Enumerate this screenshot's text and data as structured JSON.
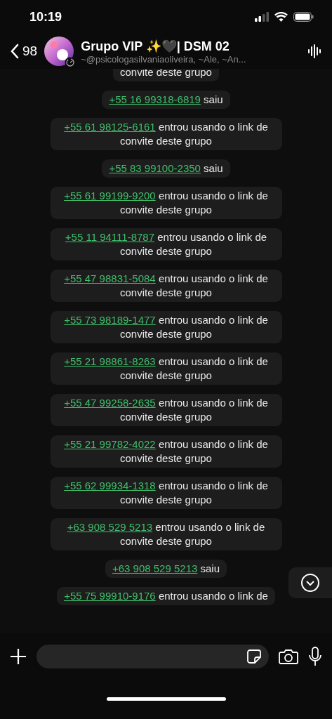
{
  "status_bar": {
    "time": "10:19"
  },
  "header": {
    "back_count": "98",
    "title": "Grupo VIP ✨🖤| DSM 02",
    "subtitle": "~@psicologasilvaniaoliveira, ~Ale, ~An..."
  },
  "messages": [
    {
      "kind": "fragment",
      "text": "convite deste grupo"
    },
    {
      "kind": "left",
      "phone": "+55 16 99318-6819",
      "text": "saiu"
    },
    {
      "kind": "join",
      "phone": "+55 61 98125-6161",
      "text": "entrou usando o link de convite deste grupo"
    },
    {
      "kind": "left",
      "phone": "+55 83 99100-2350",
      "text": "saiu"
    },
    {
      "kind": "join",
      "phone": "+55 61 99199-9200",
      "text": "entrou usando o link de convite deste grupo"
    },
    {
      "kind": "join",
      "phone": "+55 11 94111-8787",
      "text": "entrou usando o link de convite deste grupo"
    },
    {
      "kind": "join",
      "phone": "+55 47 98831-5084",
      "text": "entrou usando o link de convite deste grupo"
    },
    {
      "kind": "join",
      "phone": "+55 73 98189-1477",
      "text": "entrou usando o link de convite deste grupo"
    },
    {
      "kind": "join",
      "phone": "+55 21 98861-8263",
      "text": "entrou usando o link de convite deste grupo"
    },
    {
      "kind": "join",
      "phone": "+55 47 99258-2635",
      "text": "entrou usando o link de convite deste grupo"
    },
    {
      "kind": "join",
      "phone": "+55 21 99782-4022",
      "text": "entrou usando o link de convite deste grupo"
    },
    {
      "kind": "join",
      "phone": "+55 62 99934-1318",
      "text": "entrou usando o link de convite deste grupo"
    },
    {
      "kind": "join",
      "phone": "+63 908 529 5213",
      "text": "entrou usando o link de convite deste grupo"
    },
    {
      "kind": "left",
      "phone": "+63 908 529 5213",
      "text": "saiu"
    },
    {
      "kind": "join",
      "phone": "+55 75 99910-9176",
      "text": "entrou usando o link de"
    }
  ]
}
